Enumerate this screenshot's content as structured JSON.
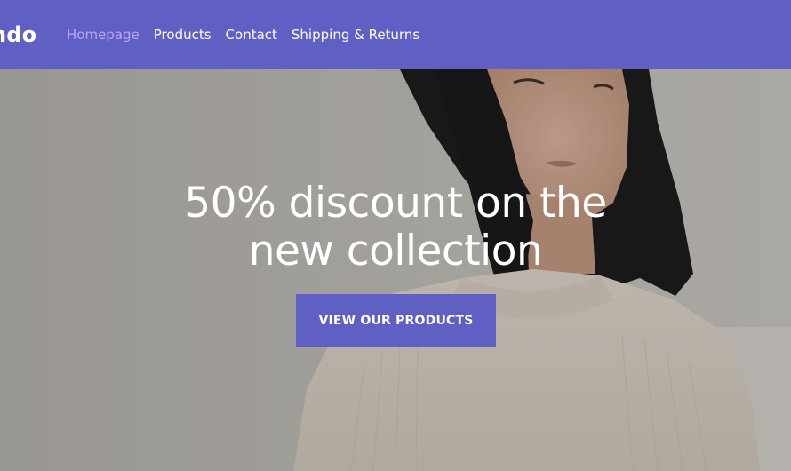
{
  "header": {
    "logo_text": "ndo",
    "nav": [
      {
        "label": "Homepage",
        "active": true
      },
      {
        "label": "Products",
        "active": false
      },
      {
        "label": "Contact",
        "active": false
      },
      {
        "label": "Shipping & Returns",
        "active": false
      }
    ]
  },
  "hero": {
    "title_line1": "50% discount on the",
    "title_line2": "new collection",
    "cta_label": "VIEW OUR PRODUCTS",
    "image": "hero-photo-woman-in-cream-sweater"
  },
  "colors": {
    "brand": "#5f5fc4",
    "nav_active": "#b9a6ff",
    "text_light": "#ffffff"
  }
}
